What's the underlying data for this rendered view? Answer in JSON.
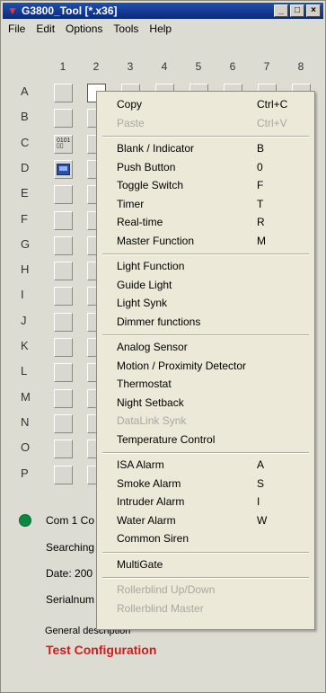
{
  "window": {
    "title": "G3800_Tool [*.x36]",
    "controls": {
      "minimize": "_",
      "maximize": "□",
      "close": "×"
    }
  },
  "menubar": [
    "File",
    "Edit",
    "Options",
    "Tools",
    "Help"
  ],
  "grid": {
    "columns": [
      "1",
      "2",
      "3",
      "4",
      "5",
      "6",
      "7",
      "8"
    ],
    "rows": [
      "A",
      "B",
      "C",
      "D",
      "E",
      "F",
      "G",
      "H",
      "I",
      "J",
      "K",
      "L",
      "M",
      "N",
      "O",
      "P"
    ]
  },
  "status": {
    "com": "Com 1 Co",
    "searching": "Searching",
    "date": "Date: 200",
    "serial": "Serialnum",
    "general": "General description",
    "config_name": "Test Configuration"
  },
  "context_menu": [
    {
      "label": "Copy",
      "key": "Ctrl+C",
      "disabled": false
    },
    {
      "label": "Paste",
      "key": "Ctrl+V",
      "disabled": true
    },
    {
      "label": "Blank / Indicator",
      "key": "B",
      "disabled": false
    },
    {
      "label": "Push Button",
      "key": "0",
      "disabled": false
    },
    {
      "label": "Toggle Switch",
      "key": "F",
      "disabled": false
    },
    {
      "label": "Timer",
      "key": "T",
      "disabled": false
    },
    {
      "label": "Real-time",
      "key": "R",
      "disabled": false
    },
    {
      "label": "Master Function",
      "key": "M",
      "disabled": false
    },
    {
      "label": "Light Function",
      "key": "",
      "disabled": false
    },
    {
      "label": "Guide Light",
      "key": "",
      "disabled": false
    },
    {
      "label": "Light Synk",
      "key": "",
      "disabled": false
    },
    {
      "label": "Dimmer functions",
      "key": "",
      "disabled": false
    },
    {
      "label": "Analog Sensor",
      "key": "",
      "disabled": false
    },
    {
      "label": "Motion / Proximity Detector",
      "key": "",
      "disabled": false
    },
    {
      "label": "Thermostat",
      "key": "",
      "disabled": false
    },
    {
      "label": "Night Setback",
      "key": "",
      "disabled": false
    },
    {
      "label": "DataLink Synk",
      "key": "",
      "disabled": true
    },
    {
      "label": "Temperature Control",
      "key": "",
      "disabled": false
    },
    {
      "label": "ISA Alarm",
      "key": "A",
      "disabled": false
    },
    {
      "label": "Smoke Alarm",
      "key": "S",
      "disabled": false
    },
    {
      "label": "Intruder Alarm",
      "key": "I",
      "disabled": false
    },
    {
      "label": "Water Alarm",
      "key": "W",
      "disabled": false
    },
    {
      "label": "Common Siren",
      "key": "",
      "disabled": false
    },
    {
      "label": "MultiGate",
      "key": "",
      "disabled": false
    },
    {
      "label": "Rollerblind Up/Down",
      "key": "",
      "disabled": true
    },
    {
      "label": "Rollerblind Master",
      "key": "",
      "disabled": true
    }
  ],
  "colors": {
    "title_bar": "#0a2a7a",
    "status_led": "#0a8a3a",
    "config_name": "#d21b1b"
  }
}
